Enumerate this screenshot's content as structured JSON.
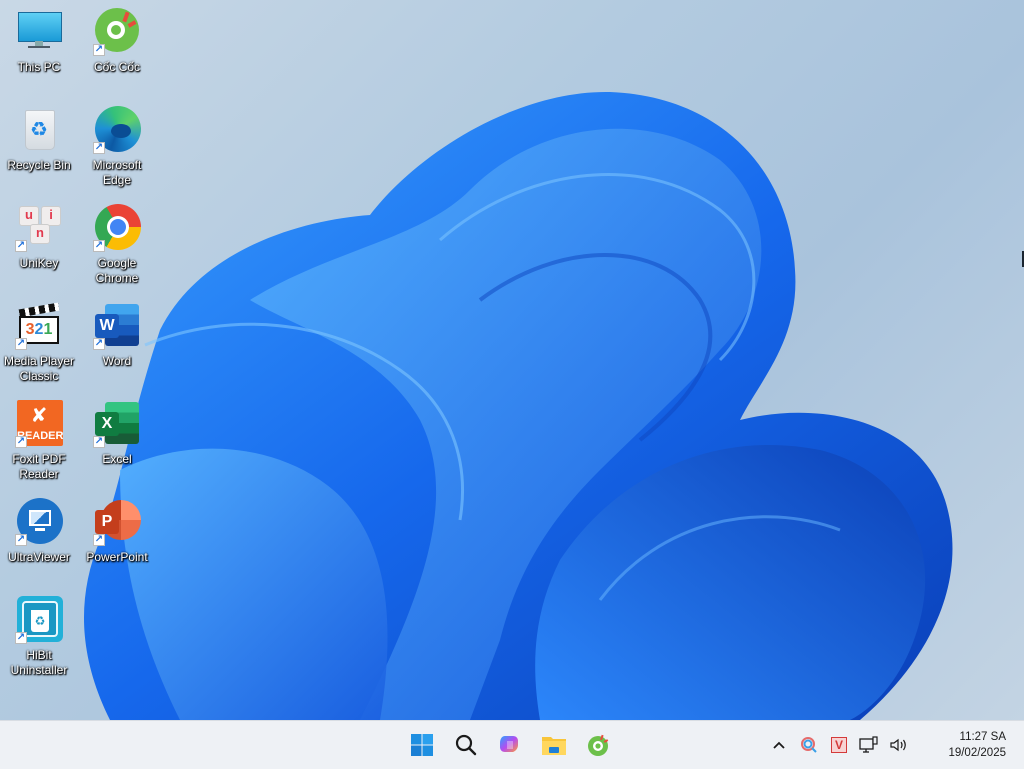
{
  "desktop": {
    "icons": [
      {
        "id": "this-pc",
        "label": "This PC",
        "shortcut": false,
        "icon": "monitor-icon"
      },
      {
        "id": "coc-coc",
        "label": "Cốc Cốc",
        "shortcut": true,
        "icon": "coccoc-icon"
      },
      {
        "id": "recycle-bin",
        "label": "Recycle Bin",
        "shortcut": false,
        "icon": "recycle-bin-icon"
      },
      {
        "id": "microsoft-edge",
        "label": "Microsoft Edge",
        "shortcut": true,
        "icon": "edge-icon"
      },
      {
        "id": "unikey",
        "label": "UniKey",
        "shortcut": true,
        "icon": "unikey-icon"
      },
      {
        "id": "google-chrome",
        "label": "Google Chrome",
        "shortcut": true,
        "icon": "chrome-icon"
      },
      {
        "id": "media-player-classic",
        "label": "Media Player Classic",
        "shortcut": true,
        "icon": "media-player-icon"
      },
      {
        "id": "word",
        "label": "Word",
        "shortcut": true,
        "icon": "word-icon"
      },
      {
        "id": "foxit-pdf-reader",
        "label": "Foxit PDF Reader",
        "shortcut": true,
        "icon": "foxit-icon"
      },
      {
        "id": "excel",
        "label": "Excel",
        "shortcut": true,
        "icon": "excel-icon"
      },
      {
        "id": "ultraviewer",
        "label": "UltraViewer",
        "shortcut": true,
        "icon": "ultraviewer-icon"
      },
      {
        "id": "powerpoint",
        "label": "PowerPoint",
        "shortcut": true,
        "icon": "powerpoint-icon"
      },
      {
        "id": "hibit-uninstaller",
        "label": "HiBit Uninstaller",
        "shortcut": true,
        "icon": "hibit-icon"
      }
    ],
    "glyph_text": {
      "unikey": [
        "u",
        "i",
        "n"
      ],
      "media_player": [
        "3",
        "2",
        "1"
      ],
      "foxit": "READER",
      "word": "W",
      "excel": "X",
      "powerpoint": "P"
    }
  },
  "taskbar": {
    "pinned": [
      {
        "name": "Start",
        "icon": "windows-start-icon"
      },
      {
        "name": "Search",
        "icon": "search-icon"
      },
      {
        "name": "Copilot",
        "icon": "copilot-icon"
      },
      {
        "name": "File Explorer",
        "icon": "file-explorer-icon"
      },
      {
        "name": "Cốc Cốc",
        "icon": "coccoc-icon"
      }
    ],
    "tray": {
      "overflow": "show-hidden-icons",
      "icons": [
        "lens-app-icon",
        "vietkey-v-icon",
        "network-icon",
        "volume-icon"
      ],
      "vietkey_letter": "V"
    },
    "clock": {
      "time": "11:27 SA",
      "date": "19/02/2025"
    }
  },
  "colors": {
    "accent": "#1a73e8",
    "wallpaper_bloom": "#1565e6",
    "taskbar_bg": "#eef1f5"
  }
}
